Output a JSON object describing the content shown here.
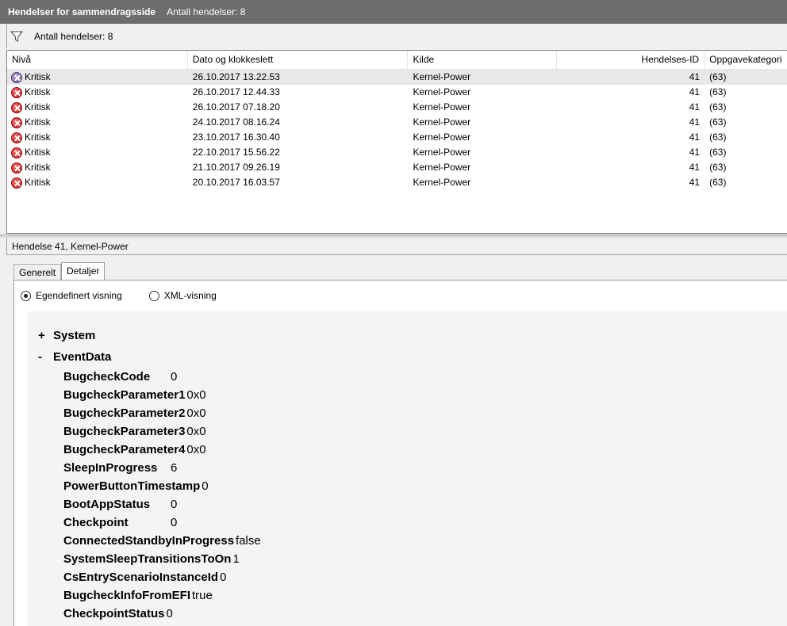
{
  "titlebar": {
    "title": "Hendelser for sammendragsside",
    "count": "Antall hendelser: 8"
  },
  "filter": {
    "count": "Antall hendelser: 8"
  },
  "columns": [
    "Nivå",
    "Dato og klokkeslett",
    "Kilde",
    "Hendelses-ID",
    "Oppgavekategori"
  ],
  "rows": [
    {
      "level": "Kritisk",
      "date": "26.10.2017 13.22.53",
      "source": "Kernel-Power",
      "id": "41",
      "cat": "(63)"
    },
    {
      "level": "Kritisk",
      "date": "26.10.2017 12.44.33",
      "source": "Kernel-Power",
      "id": "41",
      "cat": "(63)"
    },
    {
      "level": "Kritisk",
      "date": "26.10.2017 07.18.20",
      "source": "Kernel-Power",
      "id": "41",
      "cat": "(63)"
    },
    {
      "level": "Kritisk",
      "date": "24.10.2017 08.16.24",
      "source": "Kernel-Power",
      "id": "41",
      "cat": "(63)"
    },
    {
      "level": "Kritisk",
      "date": "23.10.2017 16.30.40",
      "source": "Kernel-Power",
      "id": "41",
      "cat": "(63)"
    },
    {
      "level": "Kritisk",
      "date": "22.10.2017 15.56.22",
      "source": "Kernel-Power",
      "id": "41",
      "cat": "(63)"
    },
    {
      "level": "Kritisk",
      "date": "21.10.2017 09.26.19",
      "source": "Kernel-Power",
      "id": "41",
      "cat": "(63)"
    },
    {
      "level": "Kritisk",
      "date": "20.10.2017 16.03.57",
      "source": "Kernel-Power",
      "id": "41",
      "cat": "(63)"
    }
  ],
  "details": {
    "header": "Hendelse 41, Kernel-Power",
    "tabs": [
      "Generelt",
      "Detaljer"
    ],
    "radio_custom": "Egendefinert visning",
    "radio_xml": "XML-visning",
    "system": {
      "sign": "+",
      "label": "System"
    },
    "eventdata": {
      "sign": "-",
      "label": "EventData"
    },
    "fields": [
      {
        "k": "BugcheckCode",
        "v": "0"
      },
      {
        "k": "BugcheckParameter1",
        "v": "0x0"
      },
      {
        "k": "BugcheckParameter2",
        "v": "0x0"
      },
      {
        "k": "BugcheckParameter3",
        "v": "0x0"
      },
      {
        "k": "BugcheckParameter4",
        "v": "0x0"
      },
      {
        "k": "SleepInProgress",
        "v": "6"
      },
      {
        "k": "PowerButtonTimestamp",
        "v": "0"
      },
      {
        "k": "BootAppStatus",
        "v": "0"
      },
      {
        "k": "Checkpoint",
        "v": "0"
      },
      {
        "k": "ConnectedStandbyInProgress",
        "v": "false"
      },
      {
        "k": "SystemSleepTransitionsToOn",
        "v": "1"
      },
      {
        "k": "CsEntryScenarioInstanceId",
        "v": "0"
      },
      {
        "k": "BugcheckInfoFromEFI",
        "v": "true"
      },
      {
        "k": "CheckpointStatus",
        "v": "0"
      }
    ]
  }
}
